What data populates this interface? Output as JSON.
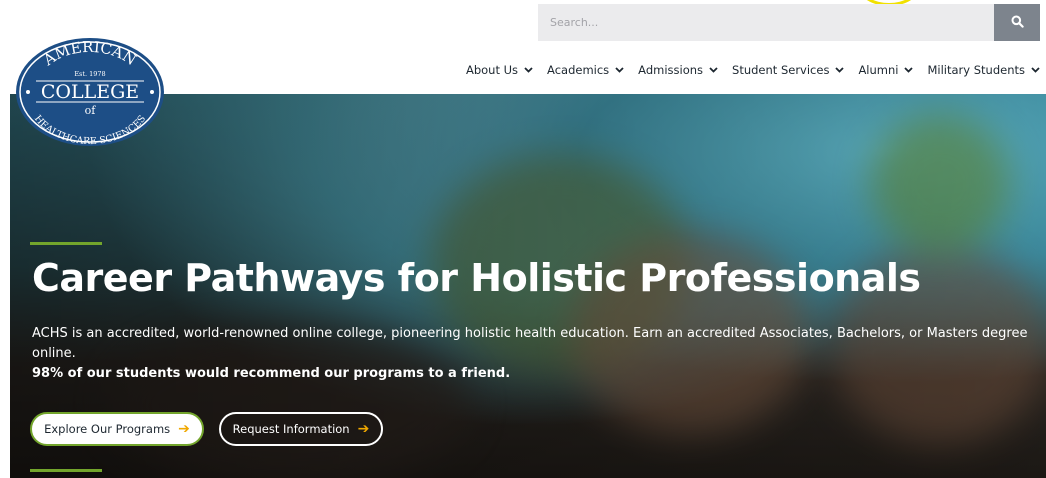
{
  "search": {
    "placeholder": "Search..."
  },
  "logo": {
    "top_text": "AMERICAN",
    "est": "Est. 1978",
    "middle_text": "COLLEGE",
    "of": "of",
    "bottom_text": "HEALTHCARE SCIENCES"
  },
  "nav": {
    "items": [
      {
        "label": "About Us"
      },
      {
        "label": "Academics"
      },
      {
        "label": "Admissions"
      },
      {
        "label": "Student Services"
      },
      {
        "label": "Alumni"
      },
      {
        "label": "Military Students"
      }
    ]
  },
  "hero": {
    "title": "Career Pathways for Holistic Professionals",
    "description": "ACHS is an accredited, world-renowned online college, pioneering holistic health education. Earn an accredited Associates, Bachelors, or Masters degree online.",
    "stat": "98% of our students would recommend our programs to a friend.",
    "primary_button": "Explore Our Programs",
    "secondary_button": "Request Information",
    "arrow_glyph": "➔"
  },
  "colors": {
    "accent_green": "#73a52c",
    "arrow_orange": "#f0a800",
    "logo_navy": "#1d4e86",
    "search_button": "#7d848d"
  }
}
